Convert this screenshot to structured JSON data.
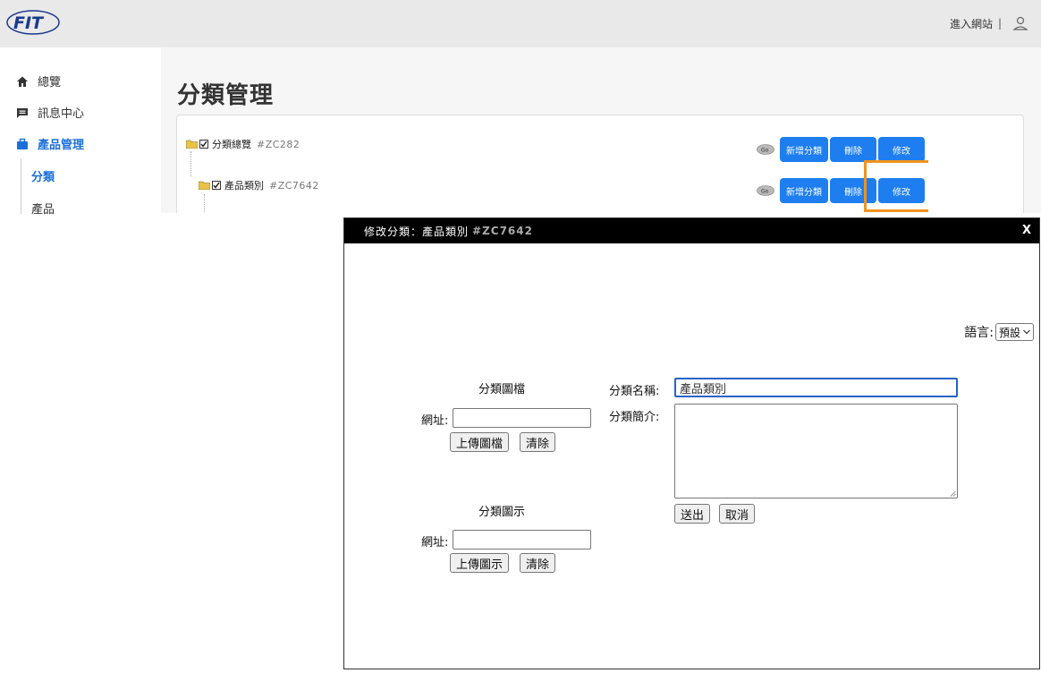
{
  "header": {
    "logo_text": "FIT",
    "enter_site": "進入網站",
    "separator": "|",
    "user_icon": "user-icon"
  },
  "sidebar": {
    "items": [
      {
        "label": "總覽",
        "icon": "home-icon"
      },
      {
        "label": "訊息中心",
        "icon": "message-icon"
      },
      {
        "label": "產品管理",
        "icon": "briefcase-icon"
      }
    ],
    "sub_items": [
      {
        "label": "分類"
      },
      {
        "label": "產品"
      }
    ]
  },
  "main": {
    "title": "分類管理",
    "tree": [
      {
        "name": "分類總覽",
        "code": "#ZC282"
      },
      {
        "name": "產品類別",
        "code": "#ZC7642"
      }
    ],
    "buttons": {
      "add": "新增分類",
      "delete": "刪除",
      "edit": "修改",
      "go_icon": "go-icon"
    }
  },
  "dialog": {
    "title": "修改分類：產品類別",
    "title_code": "#ZC7642",
    "close": "X",
    "language_label": "語言:",
    "language_value": "預設",
    "image_section": {
      "heading": "分類圖檔",
      "url_label": "網址:",
      "url_value": "",
      "upload_button": "上傳圖檔",
      "clear_button": "清除"
    },
    "icon_section": {
      "heading": "分類圖示",
      "url_label": "網址:",
      "url_value": "",
      "upload_button": "上傳圖示",
      "clear_button": "清除"
    },
    "name_label": "分類名稱:",
    "name_value": "產品類別",
    "intro_label": "分類簡介:",
    "submit_button": "送出",
    "cancel_button": "取消"
  },
  "colors": {
    "accent": "#1e7ef0",
    "highlight": "#f0931f",
    "dialog_header": "#000000"
  }
}
